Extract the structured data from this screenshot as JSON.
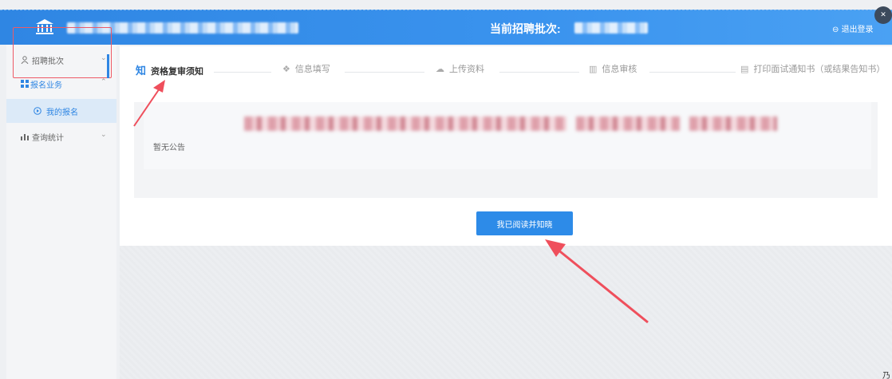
{
  "header": {
    "current_batch_label": "当前招聘批次:",
    "logout_label": "退出登录"
  },
  "sidebar": {
    "items": [
      {
        "label": "招聘批次",
        "icon": "person-icon"
      },
      {
        "label": "报名业务",
        "icon": "grid-icon"
      },
      {
        "label": "我的报名",
        "icon": "play-circle-icon"
      },
      {
        "label": "查询统计",
        "icon": "bar-chart-icon"
      }
    ]
  },
  "steps": [
    {
      "label": "资格复审须知",
      "glyph": "知",
      "current": true
    },
    {
      "label": "信息填写",
      "glyph": "❖"
    },
    {
      "label": "上传资料",
      "glyph": "☁"
    },
    {
      "label": "信息审核",
      "glyph": "▥"
    },
    {
      "label": "打印面试通知书（或结果告知书）",
      "glyph": "▤"
    }
  ],
  "notice": {
    "empty_text": "暂无公告"
  },
  "ack_button_label": "我已阅读并知晓",
  "colors": {
    "primary": "#2f86e3",
    "annotation_red": "#ee5a66"
  }
}
